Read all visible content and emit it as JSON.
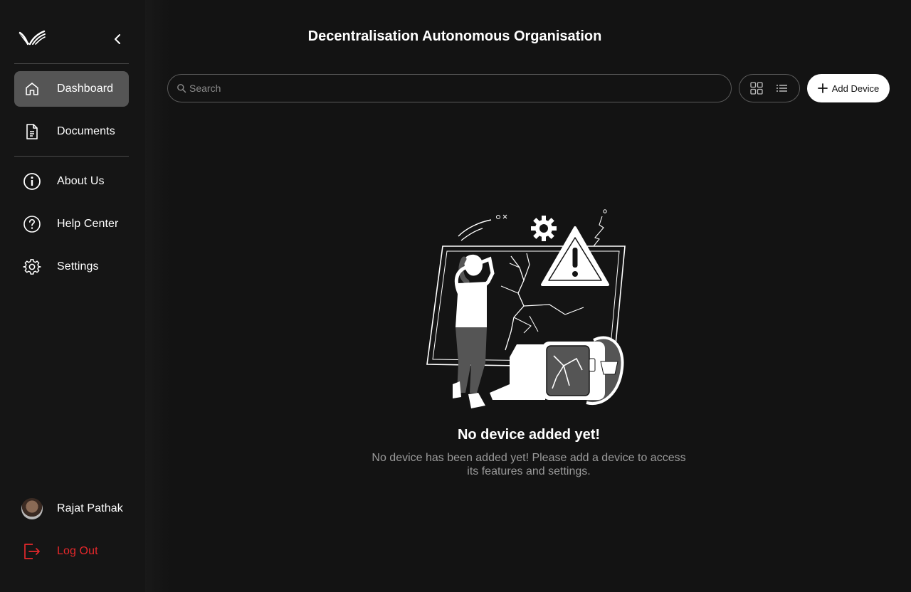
{
  "app": {
    "title": "Decentralisation Autonomous Organisation"
  },
  "sidebar": {
    "logo_icon": "logo-wings-icon",
    "collapse_icon": "chevron-left-icon",
    "items": [
      {
        "label": "Dashboard",
        "icon": "home-icon",
        "active": true
      },
      {
        "label": "Documents",
        "icon": "document-icon",
        "active": false
      },
      {
        "label": "About Us",
        "icon": "info-icon",
        "active": false
      },
      {
        "label": "Help Center",
        "icon": "help-icon",
        "active": false
      },
      {
        "label": "Settings",
        "icon": "gear-icon",
        "active": false
      }
    ],
    "user": {
      "name": "Rajat Pathak"
    },
    "logout": {
      "label": "Log Out",
      "icon": "logout-icon",
      "color": "#e5282b"
    }
  },
  "toolbar": {
    "search_placeholder": "Search",
    "search_value": "",
    "view_modes": [
      "grid-icon",
      "list-icon"
    ],
    "add_device_label": "Add Device"
  },
  "empty_state": {
    "title": "No device added yet!",
    "description": "No device has been added yet! Please add a device to access its features and settings."
  },
  "colors": {
    "background": "#131313",
    "sidebar": "#151515",
    "active_item": "#555555",
    "accent_danger": "#e5282b",
    "button_bg": "#ffffff"
  }
}
